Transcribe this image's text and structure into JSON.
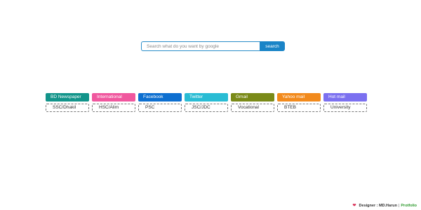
{
  "search": {
    "placeholder": "Search what do you want by google",
    "button_label": "search",
    "accent": "#1a84c7"
  },
  "links": [
    {
      "label": "BD Newspaper",
      "color": "#12948a",
      "sub": "SSC/Dhakil"
    },
    {
      "label": "International",
      "color": "#f0579e",
      "sub": "HSC/Alim"
    },
    {
      "label": "Facebook",
      "color": "#0d6fd0",
      "sub": "PSC"
    },
    {
      "label": "Twitter",
      "color": "#29bcd4",
      "sub": "JSC/JDC"
    },
    {
      "label": "Gmail",
      "color": "#7a8a18",
      "sub": "Vocational"
    },
    {
      "label": "Yahoo mail",
      "color": "#f28a1c",
      "sub": "BTEB"
    },
    {
      "label": "Hot mail",
      "color": "#7b70f0",
      "sub": "University"
    }
  ],
  "footer": {
    "icon": "heart-icon",
    "designer_label": "Designer : MD.Harun",
    "separator": "|",
    "portfolio_label": "Protfolio",
    "portfolio_color": "#2e9a2e"
  }
}
